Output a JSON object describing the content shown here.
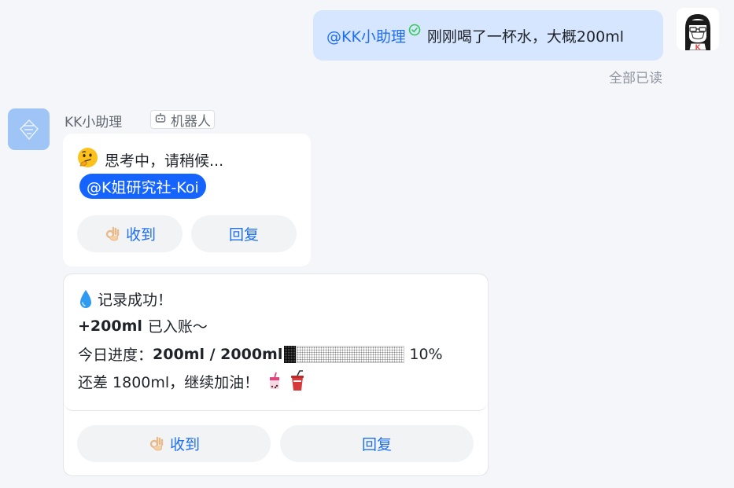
{
  "outgoing": {
    "mention": "@KK小助理",
    "text": "刚刚喝了一杯水，大概200ml",
    "read_status": "全部已读"
  },
  "bot": {
    "name": "KK小助理",
    "tag": "机器人"
  },
  "card1": {
    "thinking": "思考中，请稍候...",
    "mention": "@K姐研究社-Koi",
    "ack_label": "收到",
    "reply_label": "回复"
  },
  "card2": {
    "line1": "记录成功！",
    "amount": "+200ml",
    "line2_suffix": "已入账～",
    "progress_label": "今日进度：",
    "progress_value": "200ml / 2000ml",
    "progress_percent_text": "10%",
    "progress_fraction": 0.1,
    "remaining": "还差 1800ml，继续加油！",
    "ack_label": "收到",
    "reply_label": "回复"
  },
  "colors": {
    "accent": "#1f6ff0",
    "mention_pill": "#1664ff",
    "outgoing_bubble": "#d6e6ff",
    "verified": "#34c759"
  },
  "icons": [
    "verified-check-icon",
    "user-avatar",
    "bot-avatar-icon",
    "robot-icon",
    "thinking-face-icon",
    "ok-hand-icon",
    "water-drop-icon",
    "bubble-tea-icon",
    "drink-cup-icon"
  ]
}
